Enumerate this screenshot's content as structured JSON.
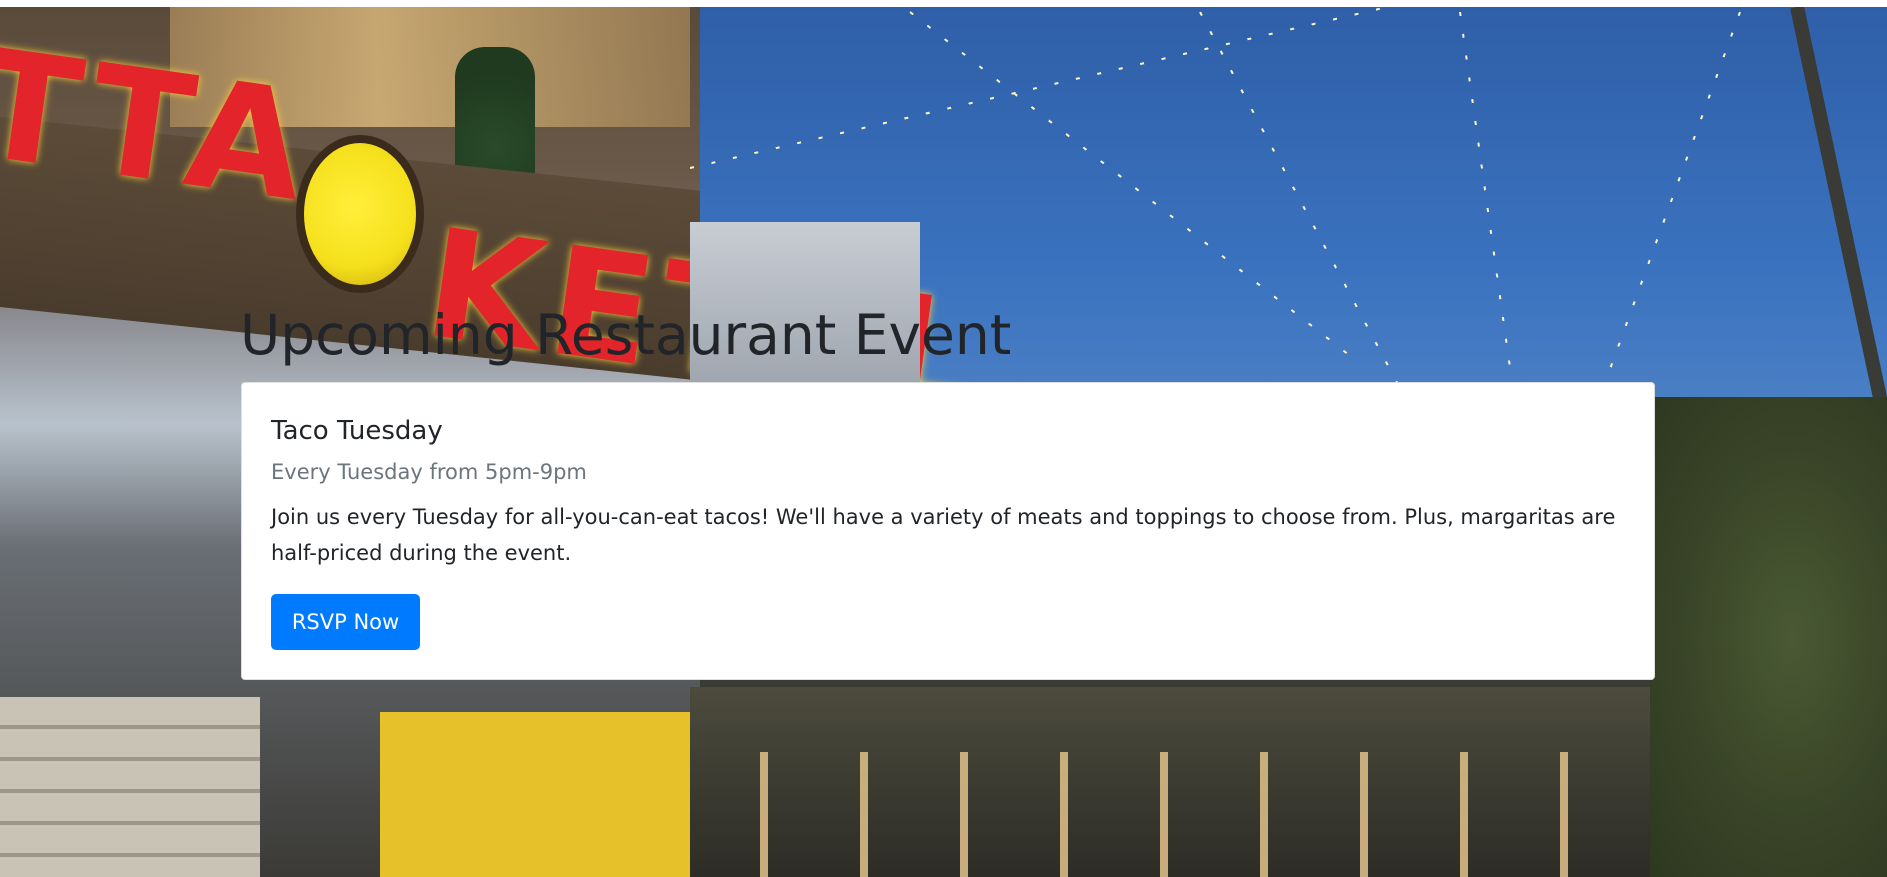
{
  "section": {
    "title": "Upcoming Restaurant Event"
  },
  "event": {
    "title": "Taco Tuesday",
    "schedule": "Every Tuesday from 5pm-9pm",
    "description": "Join us every Tuesday for all-you-can-eat tacos! We'll have a variety of meats and toppings to choose from. Plus, margaritas are half-priced during the event.",
    "rsvp_label": "RSVP Now"
  },
  "colors": {
    "primary_button": "#007bff",
    "title_text": "#212529",
    "muted_text": "#6c757d",
    "card_background": "#ffffff"
  },
  "background": {
    "sign_text_left": "TTA",
    "sign_text_right": "KETTL"
  }
}
